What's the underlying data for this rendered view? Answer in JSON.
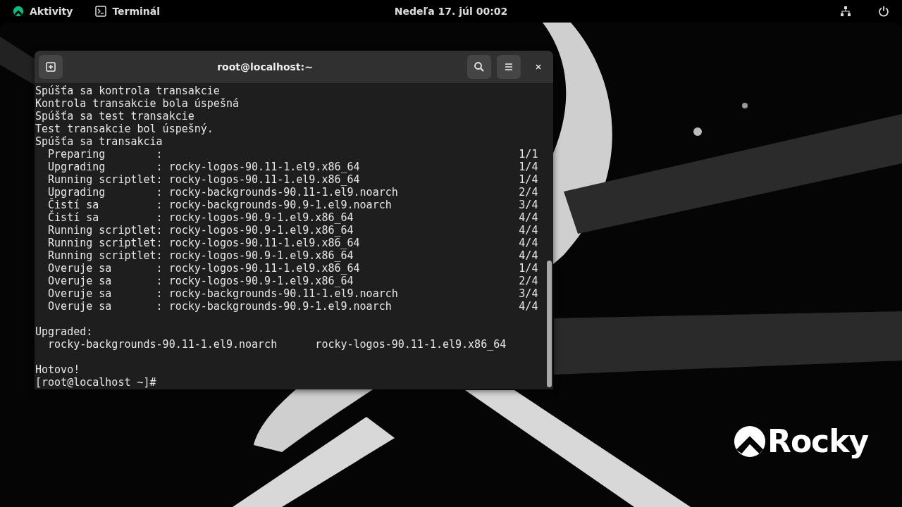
{
  "top_bar": {
    "activities": "Aktivity",
    "app_menu": "Terminál",
    "clock": "Nedeľa 17. júl  00:02"
  },
  "window": {
    "title": "root@localhost:~"
  },
  "terminal": {
    "lines": [
      "Spúšťa sa kontrola transakcie",
      "Kontrola transakcie bola úspešná",
      "Spúšťa sa test transakcie",
      "Test transakcie bol úspešný.",
      "Spúšťa sa transakcia",
      "  Preparing        :                                                        1/1",
      "  Upgrading        : rocky-logos-90.11-1.el9.x86_64                         1/4",
      "  Running scriptlet: rocky-logos-90.11-1.el9.x86_64                         1/4",
      "  Upgrading        : rocky-backgrounds-90.11-1.el9.noarch                   2/4",
      "  Čistí sa         : rocky-backgrounds-90.9-1.el9.noarch                    3/4",
      "  Čistí sa         : rocky-logos-90.9-1.el9.x86_64                          4/4",
      "  Running scriptlet: rocky-logos-90.9-1.el9.x86_64                          4/4",
      "  Running scriptlet: rocky-logos-90.11-1.el9.x86_64                         4/4",
      "  Running scriptlet: rocky-logos-90.9-1.el9.x86_64                          4/4",
      "  Overuje sa       : rocky-logos-90.11-1.el9.x86_64                         1/4",
      "  Overuje sa       : rocky-logos-90.9-1.el9.x86_64                          2/4",
      "  Overuje sa       : rocky-backgrounds-90.11-1.el9.noarch                   3/4",
      "  Overuje sa       : rocky-backgrounds-90.9-1.el9.noarch                    4/4",
      "Upgraded:",
      "  rocky-backgrounds-90.11-1.el9.noarch      rocky-logos-90.11-1.el9.x86_64",
      "Hotovo!",
      "[root@localhost ~]#"
    ]
  },
  "wallpaper": {
    "logo_text": "Rocky"
  }
}
